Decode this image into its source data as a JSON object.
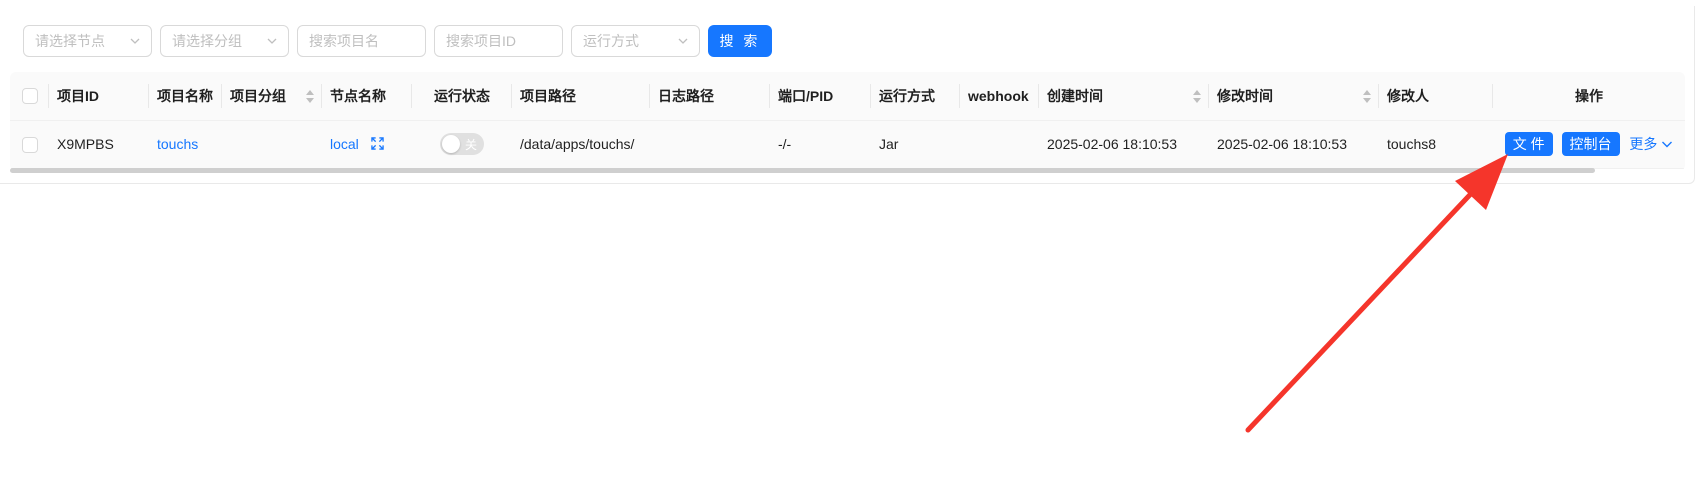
{
  "filters": {
    "node_select": "请选择节点",
    "group_select": "请选择分组",
    "name_search": "搜索项目名",
    "id_search": "搜索项目ID",
    "run_mode_select": "运行方式",
    "search_button": "搜 索"
  },
  "table": {
    "headers": {
      "project_id": "项目ID",
      "project_name": "项目名称",
      "project_group": "项目分组",
      "node_name": "节点名称",
      "run_status": "运行状态",
      "project_path": "项目路径",
      "log_path": "日志路径",
      "port_pid": "端口/PID",
      "run_mode": "运行方式",
      "webhook": "webhook",
      "created_at": "创建时间",
      "modified_at": "修改时间",
      "modified_by": "修改人",
      "actions": "操作"
    },
    "rows": [
      {
        "project_id": "X9MPBS",
        "project_name": "touchs",
        "project_group": "",
        "node_name": "local",
        "run_status_label": "关",
        "run_status_on": false,
        "project_path": "/data/apps/touchs/",
        "log_path": "",
        "port_pid": "-/-",
        "run_mode": "Jar",
        "webhook": "",
        "created_at": "2025-02-06 18:10:53",
        "modified_at": "2025-02-06 18:10:53",
        "modified_by": "touchs8",
        "actions": {
          "file": "文 件",
          "console": "控制台",
          "more": "更多"
        }
      }
    ]
  },
  "colors": {
    "primary": "#1677ff",
    "annotation_arrow": "#f5352b"
  }
}
